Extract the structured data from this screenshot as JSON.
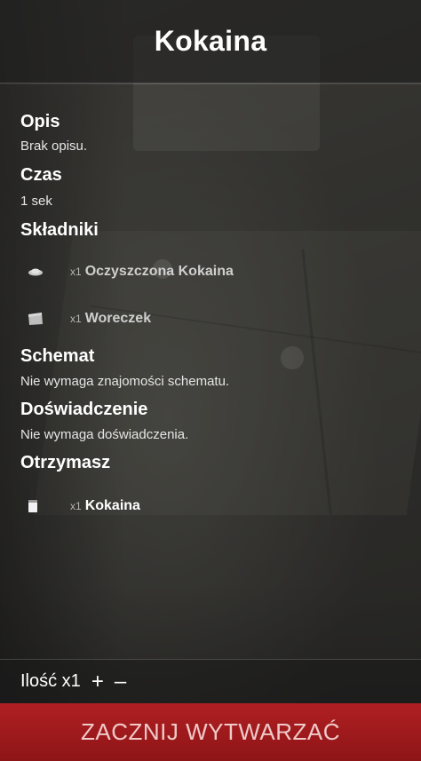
{
  "title": "Kokaina",
  "description": {
    "heading": "Opis",
    "text": "Brak opisu."
  },
  "time": {
    "heading": "Czas",
    "text": "1 sek"
  },
  "ingredients": {
    "heading": "Składniki",
    "items": [
      {
        "qty": "x1",
        "name": "Oczyszczona Kokaina",
        "icon": "powder-pile-icon"
      },
      {
        "qty": "x1",
        "name": "Woreczek",
        "icon": "bag-icon"
      }
    ]
  },
  "schematic": {
    "heading": "Schemat",
    "text": "Nie wymaga znajomości schematu."
  },
  "experience": {
    "heading": "Doświadczenie",
    "text": "Nie wymaga doświadczenia."
  },
  "output": {
    "heading": "Otrzymasz",
    "items": [
      {
        "qty": "x1",
        "name": "Kokaina",
        "icon": "cocaine-bag-icon"
      }
    ]
  },
  "quantity": {
    "label": "Ilość x1",
    "plus": "+",
    "minus": "–"
  },
  "start_button": "ZACZNIJ WYTWARZAĆ"
}
